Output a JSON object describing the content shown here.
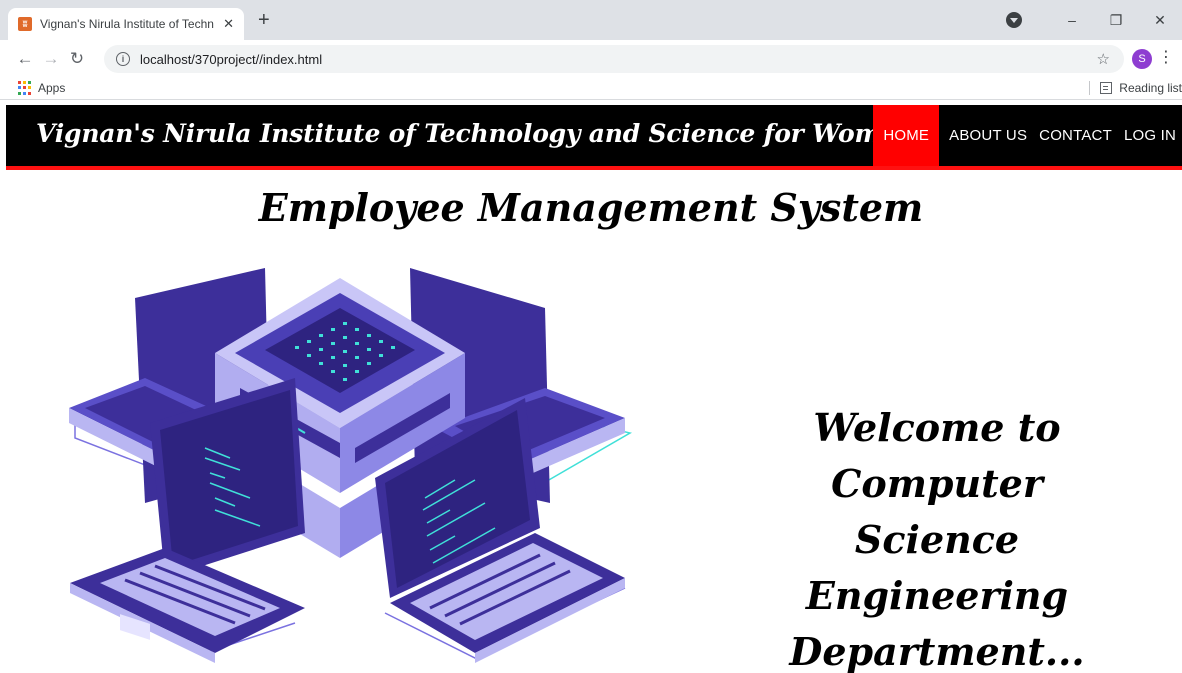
{
  "browser": {
    "tab_title": "Vignan's Nirula Institute of Techn",
    "tab_close": "✕",
    "new_tab": "+",
    "url": "localhost/370project//index.html",
    "avatar_letter": "S",
    "bookmarks_apps": "Apps",
    "reading_list": "Reading list",
    "window_minimize": "–",
    "window_restore": "❐",
    "window_close": "✕"
  },
  "site": {
    "title": "Vignan's Nirula Institute of Technology and Science for Women",
    "nav": [
      {
        "label": "HOME",
        "active": true
      },
      {
        "label": "ABOUT US",
        "active": false
      },
      {
        "label": "CONTACT",
        "active": false
      },
      {
        "label": "LOG IN",
        "active": false
      }
    ],
    "heading": "Employee Management System",
    "welcome_lines": [
      "Welcome to Computer",
      "Science Engineering",
      "Department..."
    ],
    "illustration": "isometric-server-laptops-illustration"
  },
  "colors": {
    "header_bg": "#000000",
    "header_border": "#ff1111",
    "active_nav": "#ff0000",
    "illustration_primary": "#3d2f9a",
    "illustration_light": "#b9b6f2",
    "illustration_accent": "#40e0d8"
  }
}
